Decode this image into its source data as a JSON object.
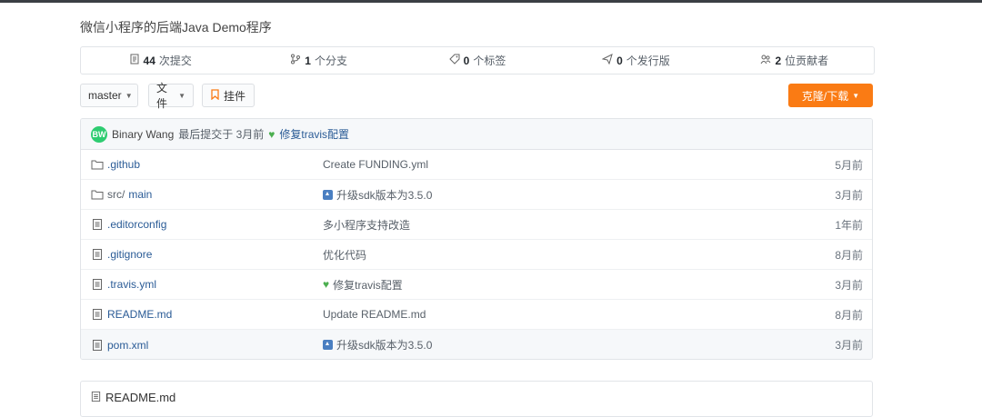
{
  "repo": {
    "description": "微信小程序的后端Java Demo程序"
  },
  "stats": {
    "commits": {
      "count": "44",
      "label": "次提交"
    },
    "branches": {
      "count": "1",
      "label": "个分支"
    },
    "tags": {
      "count": "0",
      "label": "个标签"
    },
    "releases": {
      "count": "0",
      "label": "个发行版"
    },
    "contributors": {
      "count": "2",
      "label": "位贡献者"
    }
  },
  "toolbar": {
    "branch_label": "master",
    "file_label": "文件",
    "watch_label": "挂件",
    "clone_label": "克隆/下载"
  },
  "last_commit": {
    "avatar_initials": "BW",
    "author": "Binary Wang",
    "meta": "最后提交于 3月前",
    "message": "修复travis配置"
  },
  "files": [
    {
      "name": ".github",
      "type": "folder",
      "commit": "Create FUNDING.yml",
      "commit_icon": "",
      "age": "5月前"
    },
    {
      "name_prefix": "src/",
      "name": "main",
      "type": "folder",
      "commit": "升级sdk版本为3.5.0",
      "commit_icon": "up-arrow-icon",
      "age": "3月前"
    },
    {
      "name": ".editorconfig",
      "type": "file",
      "commit": "多小程序支持改造",
      "commit_icon": "",
      "age": "1年前"
    },
    {
      "name": ".gitignore",
      "type": "file",
      "commit": "优化代码",
      "commit_icon": "",
      "age": "8月前"
    },
    {
      "name": ".travis.yml",
      "type": "file",
      "commit": "修复travis配置",
      "commit_icon": "green-heart-icon",
      "age": "3月前"
    },
    {
      "name": "README.md",
      "type": "file",
      "commit": "Update README.md",
      "commit_icon": "",
      "age": "8月前"
    },
    {
      "name": "pom.xml",
      "type": "file",
      "commit": "升级sdk版本为3.5.0",
      "commit_icon": "up-arrow-icon",
      "age": "3月前"
    }
  ],
  "readme": {
    "title": "README.md"
  },
  "colors": {
    "accent": "#fa7b14",
    "link": "#2a5b96",
    "avatar": "#2ecc71"
  }
}
